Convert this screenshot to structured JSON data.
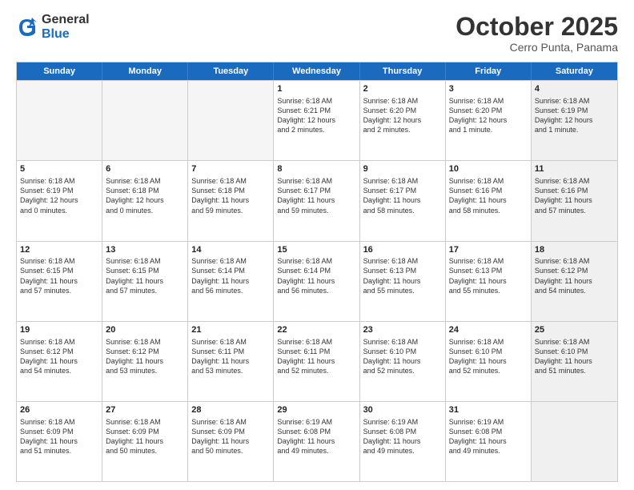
{
  "header": {
    "logo": {
      "general": "General",
      "blue": "Blue"
    },
    "title": "October 2025",
    "subtitle": "Cerro Punta, Panama"
  },
  "weekdays": [
    "Sunday",
    "Monday",
    "Tuesday",
    "Wednesday",
    "Thursday",
    "Friday",
    "Saturday"
  ],
  "rows": [
    [
      {
        "day": "",
        "lines": [],
        "empty": true
      },
      {
        "day": "",
        "lines": [],
        "empty": true
      },
      {
        "day": "",
        "lines": [],
        "empty": true
      },
      {
        "day": "1",
        "lines": [
          "Sunrise: 6:18 AM",
          "Sunset: 6:21 PM",
          "Daylight: 12 hours",
          "and 2 minutes."
        ]
      },
      {
        "day": "2",
        "lines": [
          "Sunrise: 6:18 AM",
          "Sunset: 6:20 PM",
          "Daylight: 12 hours",
          "and 2 minutes."
        ]
      },
      {
        "day": "3",
        "lines": [
          "Sunrise: 6:18 AM",
          "Sunset: 6:20 PM",
          "Daylight: 12 hours",
          "and 1 minute."
        ]
      },
      {
        "day": "4",
        "lines": [
          "Sunrise: 6:18 AM",
          "Sunset: 6:19 PM",
          "Daylight: 12 hours",
          "and 1 minute."
        ],
        "shaded": true
      }
    ],
    [
      {
        "day": "5",
        "lines": [
          "Sunrise: 6:18 AM",
          "Sunset: 6:19 PM",
          "Daylight: 12 hours",
          "and 0 minutes."
        ]
      },
      {
        "day": "6",
        "lines": [
          "Sunrise: 6:18 AM",
          "Sunset: 6:18 PM",
          "Daylight: 12 hours",
          "and 0 minutes."
        ]
      },
      {
        "day": "7",
        "lines": [
          "Sunrise: 6:18 AM",
          "Sunset: 6:18 PM",
          "Daylight: 11 hours",
          "and 59 minutes."
        ]
      },
      {
        "day": "8",
        "lines": [
          "Sunrise: 6:18 AM",
          "Sunset: 6:17 PM",
          "Daylight: 11 hours",
          "and 59 minutes."
        ]
      },
      {
        "day": "9",
        "lines": [
          "Sunrise: 6:18 AM",
          "Sunset: 6:17 PM",
          "Daylight: 11 hours",
          "and 58 minutes."
        ]
      },
      {
        "day": "10",
        "lines": [
          "Sunrise: 6:18 AM",
          "Sunset: 6:16 PM",
          "Daylight: 11 hours",
          "and 58 minutes."
        ]
      },
      {
        "day": "11",
        "lines": [
          "Sunrise: 6:18 AM",
          "Sunset: 6:16 PM",
          "Daylight: 11 hours",
          "and 57 minutes."
        ],
        "shaded": true
      }
    ],
    [
      {
        "day": "12",
        "lines": [
          "Sunrise: 6:18 AM",
          "Sunset: 6:15 PM",
          "Daylight: 11 hours",
          "and 57 minutes."
        ]
      },
      {
        "day": "13",
        "lines": [
          "Sunrise: 6:18 AM",
          "Sunset: 6:15 PM",
          "Daylight: 11 hours",
          "and 57 minutes."
        ]
      },
      {
        "day": "14",
        "lines": [
          "Sunrise: 6:18 AM",
          "Sunset: 6:14 PM",
          "Daylight: 11 hours",
          "and 56 minutes."
        ]
      },
      {
        "day": "15",
        "lines": [
          "Sunrise: 6:18 AM",
          "Sunset: 6:14 PM",
          "Daylight: 11 hours",
          "and 56 minutes."
        ]
      },
      {
        "day": "16",
        "lines": [
          "Sunrise: 6:18 AM",
          "Sunset: 6:13 PM",
          "Daylight: 11 hours",
          "and 55 minutes."
        ]
      },
      {
        "day": "17",
        "lines": [
          "Sunrise: 6:18 AM",
          "Sunset: 6:13 PM",
          "Daylight: 11 hours",
          "and 55 minutes."
        ]
      },
      {
        "day": "18",
        "lines": [
          "Sunrise: 6:18 AM",
          "Sunset: 6:12 PM",
          "Daylight: 11 hours",
          "and 54 minutes."
        ],
        "shaded": true
      }
    ],
    [
      {
        "day": "19",
        "lines": [
          "Sunrise: 6:18 AM",
          "Sunset: 6:12 PM",
          "Daylight: 11 hours",
          "and 54 minutes."
        ]
      },
      {
        "day": "20",
        "lines": [
          "Sunrise: 6:18 AM",
          "Sunset: 6:12 PM",
          "Daylight: 11 hours",
          "and 53 minutes."
        ]
      },
      {
        "day": "21",
        "lines": [
          "Sunrise: 6:18 AM",
          "Sunset: 6:11 PM",
          "Daylight: 11 hours",
          "and 53 minutes."
        ]
      },
      {
        "day": "22",
        "lines": [
          "Sunrise: 6:18 AM",
          "Sunset: 6:11 PM",
          "Daylight: 11 hours",
          "and 52 minutes."
        ]
      },
      {
        "day": "23",
        "lines": [
          "Sunrise: 6:18 AM",
          "Sunset: 6:10 PM",
          "Daylight: 11 hours",
          "and 52 minutes."
        ]
      },
      {
        "day": "24",
        "lines": [
          "Sunrise: 6:18 AM",
          "Sunset: 6:10 PM",
          "Daylight: 11 hours",
          "and 52 minutes."
        ]
      },
      {
        "day": "25",
        "lines": [
          "Sunrise: 6:18 AM",
          "Sunset: 6:10 PM",
          "Daylight: 11 hours",
          "and 51 minutes."
        ],
        "shaded": true
      }
    ],
    [
      {
        "day": "26",
        "lines": [
          "Sunrise: 6:18 AM",
          "Sunset: 6:09 PM",
          "Daylight: 11 hours",
          "and 51 minutes."
        ]
      },
      {
        "day": "27",
        "lines": [
          "Sunrise: 6:18 AM",
          "Sunset: 6:09 PM",
          "Daylight: 11 hours",
          "and 50 minutes."
        ]
      },
      {
        "day": "28",
        "lines": [
          "Sunrise: 6:18 AM",
          "Sunset: 6:09 PM",
          "Daylight: 11 hours",
          "and 50 minutes."
        ]
      },
      {
        "day": "29",
        "lines": [
          "Sunrise: 6:19 AM",
          "Sunset: 6:08 PM",
          "Daylight: 11 hours",
          "and 49 minutes."
        ]
      },
      {
        "day": "30",
        "lines": [
          "Sunrise: 6:19 AM",
          "Sunset: 6:08 PM",
          "Daylight: 11 hours",
          "and 49 minutes."
        ]
      },
      {
        "day": "31",
        "lines": [
          "Sunrise: 6:19 AM",
          "Sunset: 6:08 PM",
          "Daylight: 11 hours",
          "and 49 minutes."
        ]
      },
      {
        "day": "",
        "lines": [],
        "empty": true,
        "shaded": true
      }
    ]
  ]
}
